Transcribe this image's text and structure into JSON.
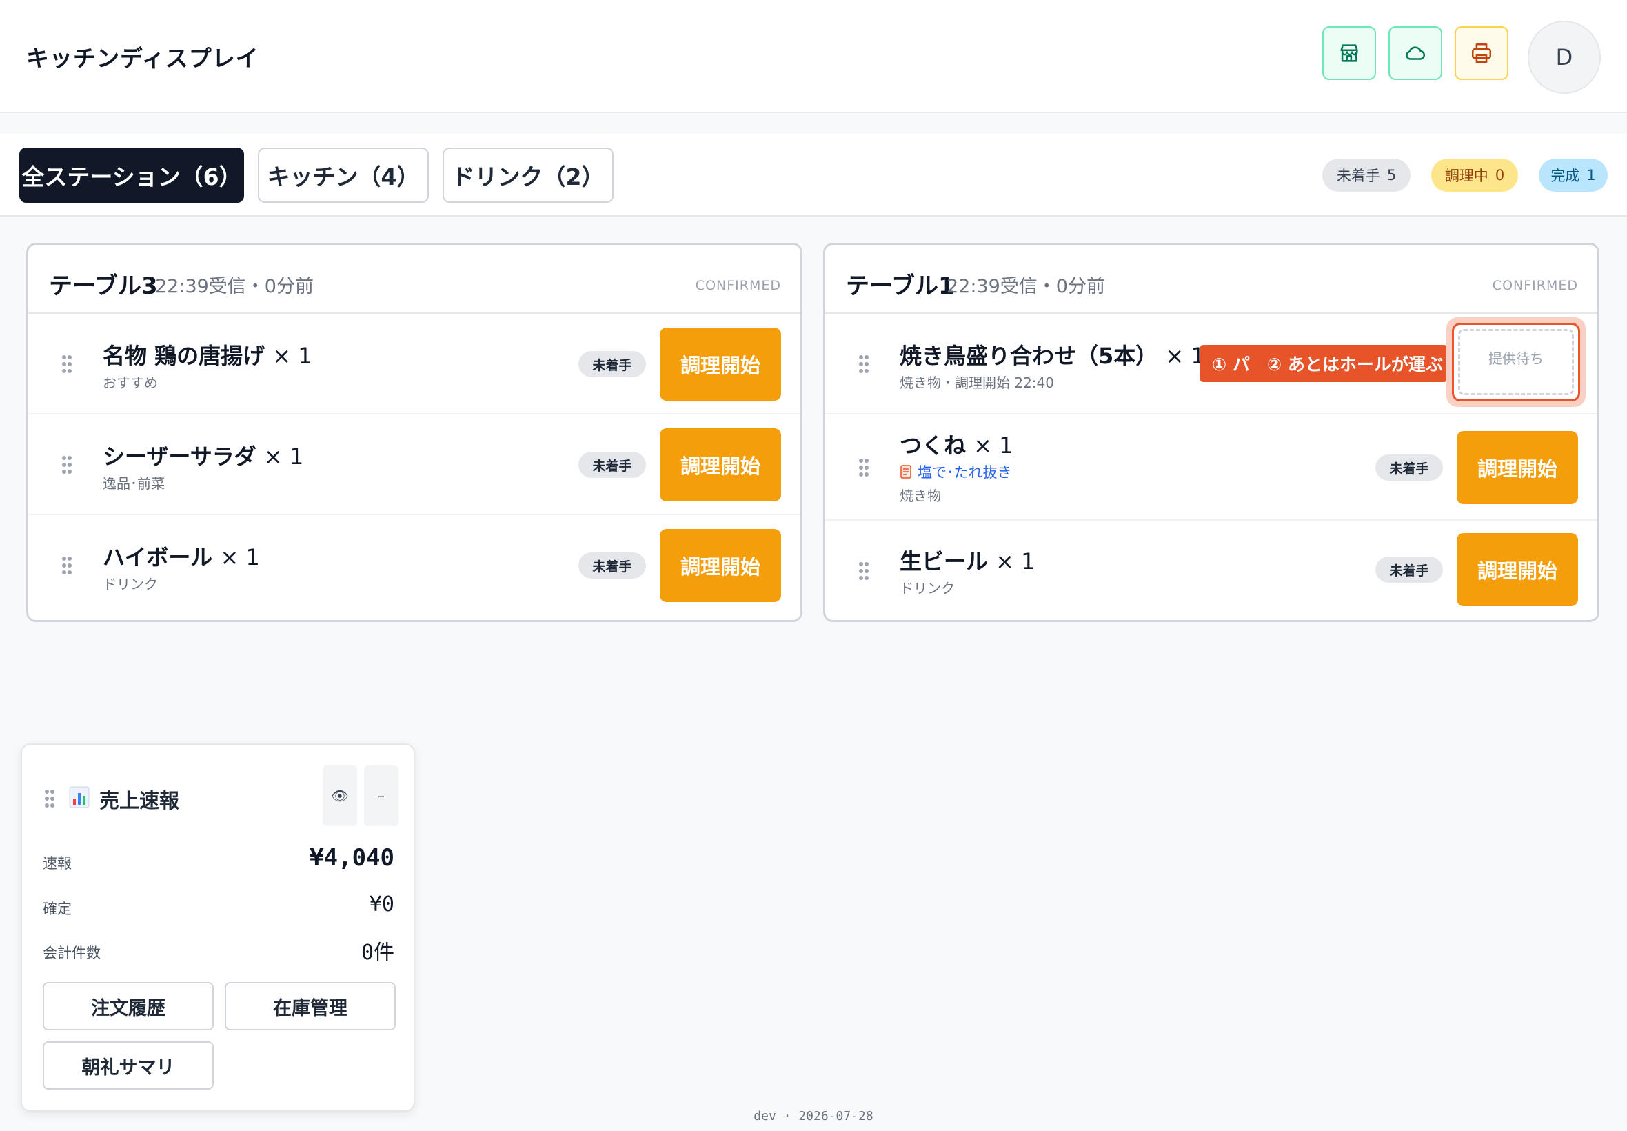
{
  "header": {
    "title": "キッチンディスプレイ",
    "avatar_initial": "D",
    "icons": [
      "store-icon",
      "cloud-icon",
      "printer-icon"
    ],
    "colors": {
      "store": "#047857",
      "cloud": "#047857",
      "printer": "#c2410c"
    }
  },
  "tabs": [
    {
      "label": "全ステーション（6）",
      "active": true
    },
    {
      "label": "キッチン（4）",
      "active": false
    },
    {
      "label": "ドリンク（2）",
      "active": false
    }
  ],
  "status_counts": [
    {
      "label": "未着手",
      "count": "5"
    },
    {
      "label": "調理中",
      "count": "0"
    },
    {
      "label": "完成",
      "count": "1"
    }
  ],
  "orders": [
    {
      "table": "テーブル3",
      "time": "22:39受信・0分前",
      "status": "CONFIRMED",
      "items": [
        {
          "name": "名物 鶏の唐揚げ",
          "qty": "× 1",
          "sub": "おすすめ",
          "badge": "未着手",
          "action": "調理開始"
        },
        {
          "name": "シーザーサラダ",
          "qty": "× 1",
          "sub": "逸品･前菜",
          "badge": "未着手",
          "action": "調理開始"
        },
        {
          "name": "ハイボール",
          "qty": "× 1",
          "sub": "ドリンク",
          "badge": "未着手",
          "action": "調理開始"
        }
      ]
    },
    {
      "table": "テーブル1",
      "time": "22:39受信・0分前",
      "status": "CONFIRMED",
      "items": [
        {
          "name": "焼き鳥盛り合わせ（5本）",
          "qty": "× 1",
          "sub": "焼き物・調理開始 22:40",
          "waiting": "提供待ち"
        },
        {
          "name": "つくね",
          "qty": "× 1",
          "note": "塩で･たれ抜き",
          "sub": "焼き物",
          "badge": "未着手",
          "action": "調理開始"
        },
        {
          "name": "生ビール",
          "qty": "× 1",
          "sub": "ドリンク",
          "badge": "未着手",
          "action": "調理開始"
        }
      ]
    }
  ],
  "guide": {
    "step1": "① パ",
    "step2": "② あとはホールが運ぶ"
  },
  "sales_widget": {
    "title": "売上速報",
    "eye": "👁",
    "minimize": "–",
    "rows": [
      {
        "label": "速報",
        "value": "¥4,040"
      },
      {
        "label": "確定",
        "value": "¥0"
      },
      {
        "label": "会計件数",
        "value": "0件"
      }
    ],
    "actions": [
      "注文履歴",
      "在庫管理",
      "朝礼サマリ"
    ]
  },
  "footer": "dev · 2026-07-28"
}
